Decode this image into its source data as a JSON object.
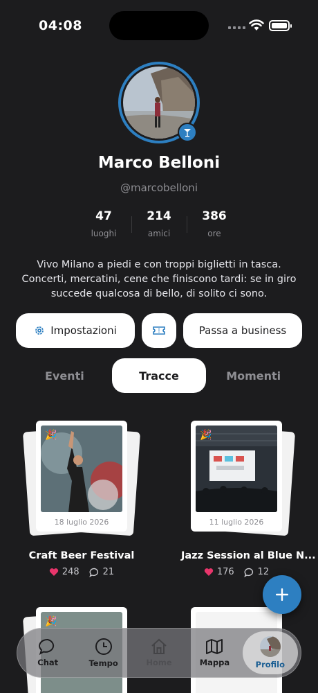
{
  "status_bar": {
    "time": "04:08"
  },
  "profile": {
    "name": "Marco Belloni",
    "handle": "@marcobelloni",
    "stats": [
      {
        "value": "47",
        "label": "luoghi"
      },
      {
        "value": "214",
        "label": "amici"
      },
      {
        "value": "386",
        "label": "ore"
      }
    ],
    "bio_lines": [
      "Vivo Milano a piedi e con troppi biglietti in tasca.",
      "Concerti, mercatini, cene che finiscono tardi: se in giro",
      "succede qualcosa di bello, di solito ci sono."
    ]
  },
  "actions": {
    "settings_label": "Impostazioni",
    "business_label": "Passa a business"
  },
  "tabs": [
    "Eventi",
    "Tracce",
    "Momenti"
  ],
  "active_tab": "Tracce",
  "cards": [
    {
      "date": "18 luglio 2026",
      "title": "Craft Beer Festival",
      "likes": "248",
      "comments": "21"
    },
    {
      "date": "11 luglio 2026",
      "title": "Jazz Session al Blue N...",
      "likes": "176",
      "comments": "12"
    }
  ],
  "tab_bar": [
    {
      "label": "Chat",
      "icon": "chat-bubble-icon"
    },
    {
      "label": "Tempo",
      "icon": "clock-icon"
    },
    {
      "label": "Home",
      "icon": "home-icon"
    },
    {
      "label": "Mappa",
      "icon": "map-icon"
    },
    {
      "label": "Profilo",
      "icon": "avatar"
    }
  ],
  "colors": {
    "accent": "#2d7fc1",
    "background": "#1c1c1e",
    "like": "#e8356b"
  }
}
